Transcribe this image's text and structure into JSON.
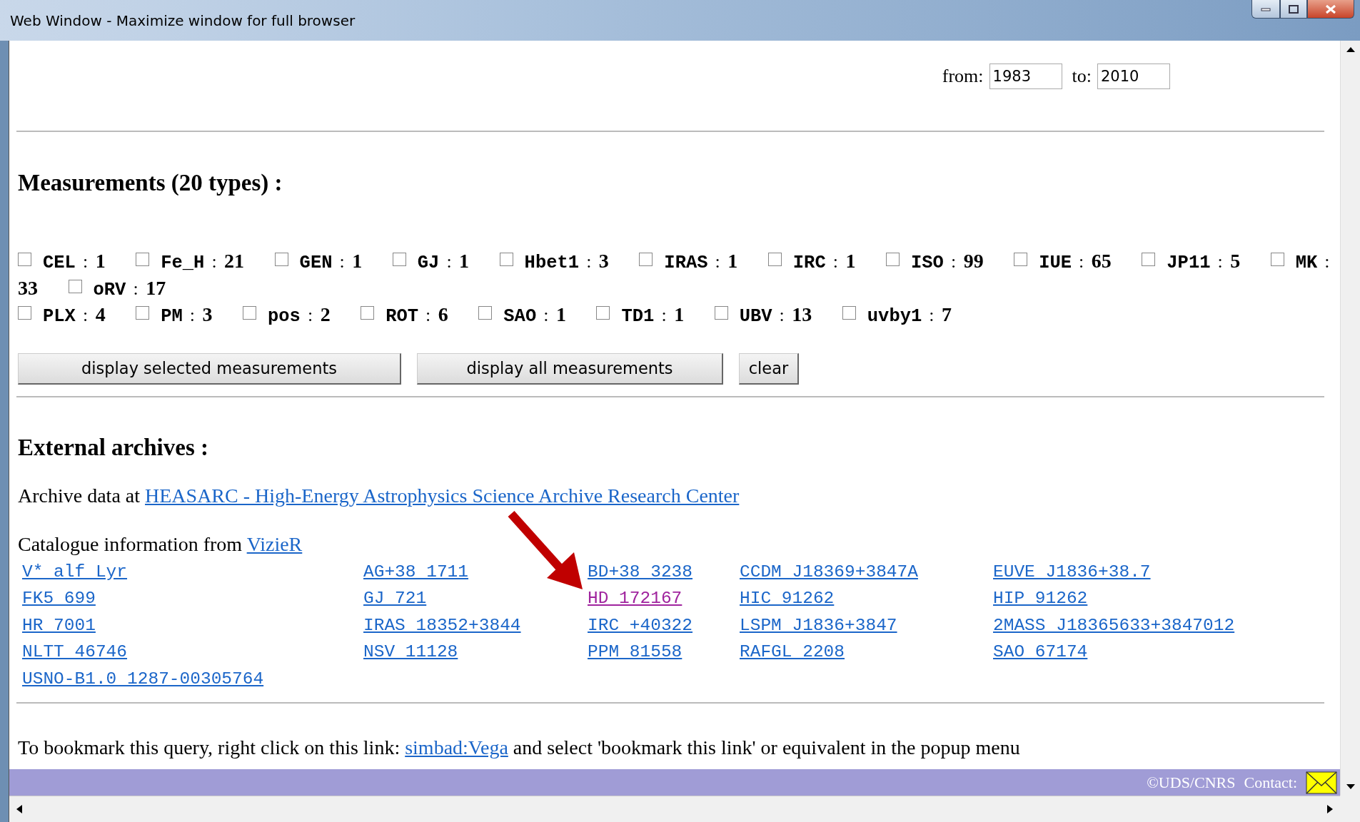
{
  "window": {
    "title": "Web Window - Maximize window for full browser"
  },
  "date_range": {
    "from_label": "from:",
    "from_value": "1983",
    "to_label": "to:",
    "to_value": "2010"
  },
  "measurements": {
    "heading": "Measurements (20 types) :",
    "separator": ":",
    "groups": [
      [
        {
          "label": "CEL",
          "count": "1",
          "checked": false
        },
        {
          "label": "Fe_H",
          "count": "21",
          "checked": false
        },
        {
          "label": "GEN",
          "count": "1",
          "checked": false
        },
        {
          "label": "GJ",
          "count": "1",
          "checked": false
        },
        {
          "label": "Hbet1",
          "count": "3",
          "checked": false
        },
        {
          "label": "IRAS",
          "count": "1",
          "checked": false
        },
        {
          "label": "IRC",
          "count": "1",
          "checked": false
        },
        {
          "label": "ISO",
          "count": "99",
          "checked": false
        },
        {
          "label": "IUE",
          "count": "65",
          "checked": false
        },
        {
          "label": "JP11",
          "count": "5",
          "checked": false
        },
        {
          "label": "MK",
          "count": "33",
          "checked": false
        },
        {
          "label": "oRV",
          "count": "17",
          "checked": false
        }
      ],
      [
        {
          "label": "PLX",
          "count": "4",
          "checked": false
        },
        {
          "label": "PM",
          "count": "3",
          "checked": false
        },
        {
          "label": "pos",
          "count": "2",
          "checked": false
        },
        {
          "label": "ROT",
          "count": "6",
          "checked": false
        },
        {
          "label": "SAO",
          "count": "1",
          "checked": false
        },
        {
          "label": "TD1",
          "count": "1",
          "checked": false
        },
        {
          "label": "UBV",
          "count": "13",
          "checked": false
        },
        {
          "label": "uvby1",
          "count": "7",
          "checked": false
        }
      ]
    ],
    "buttons": [
      "display selected measurements",
      "display all measurements",
      "clear"
    ]
  },
  "external_archives": {
    "heading": "External archives :",
    "archive_prefix": "Archive data at",
    "archive_link": "HEASARC - High-Energy Astrophysics Science Archive Research Center",
    "catalogue_prefix": "Catalogue information from",
    "catalogue_link": "VizieR",
    "identifiers": [
      [
        {
          "text": "V* alf Lyr",
          "visited": false
        },
        {
          "text": "AG+38 1711",
          "visited": false
        },
        {
          "text": "BD+38 3238",
          "visited": false
        },
        {
          "text": "CCDM J18369+3847A",
          "visited": false
        },
        {
          "text": "EUVE J1836+38.7",
          "visited": false
        }
      ],
      [
        {
          "text": "FK5 699",
          "visited": false
        },
        {
          "text": "GJ 721",
          "visited": false
        },
        {
          "text": "HD 172167",
          "visited": true
        },
        {
          "text": "HIC 91262",
          "visited": false
        },
        {
          "text": "HIP 91262",
          "visited": false
        }
      ],
      [
        {
          "text": "HR 7001",
          "visited": false
        },
        {
          "text": "IRAS 18352+3844",
          "visited": false
        },
        {
          "text": "IRC +40322",
          "visited": false
        },
        {
          "text": "LSPM J1836+3847",
          "visited": false
        },
        {
          "text": "2MASS J18365633+3847012",
          "visited": false
        }
      ],
      [
        {
          "text": "NLTT 46746",
          "visited": false
        },
        {
          "text": "NSV 11128",
          "visited": false
        },
        {
          "text": "PPM 81558",
          "visited": false
        },
        {
          "text": "RAFGL 2208",
          "visited": false
        },
        {
          "text": "SAO 67174",
          "visited": false
        }
      ],
      [
        {
          "text": "USNO-B1.0 1287-00305764",
          "visited": false
        }
      ]
    ]
  },
  "bookmark": {
    "prefix": "To bookmark this query, right click on this link:",
    "link": "simbad:Vega",
    "suffix": "and select 'bookmark this link' or equivalent in the popup menu"
  },
  "footer": {
    "copyright": "©UDS/CNRS",
    "contact": "Contact:"
  }
}
